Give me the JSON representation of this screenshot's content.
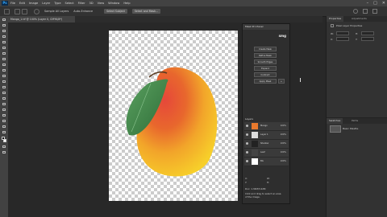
{
  "app": {
    "logo": "Ps"
  },
  "menu": [
    "File",
    "Edit",
    "Image",
    "Layer",
    "Type",
    "Select",
    "Filter",
    "3D",
    "View",
    "Window",
    "Help"
  ],
  "window_controls": {
    "minimize": "–",
    "maximize": "□",
    "close": "✕"
  },
  "options_bar": {
    "sample_all_layers": "Sample All Layers",
    "auto_enhance": "Auto-Enhance",
    "select_subject": "Select Subject",
    "select_mask": "Select and Mask..."
  },
  "document": {
    "tab_title": "Mango_1.tif @ 100% (Layer 0, CMYK/8*)"
  },
  "plugin_panel": {
    "header": "Mask Pro Panel",
    "logo": "smg",
    "buttons": [
      "Create Mask",
      "Refine Mask",
      "Smooth Edges",
      "Expand",
      "Contract",
      "Apply Mask"
    ],
    "small_button": "+",
    "layers_title": "Layers",
    "layers": [
      {
        "name": "Mango",
        "value": "100%"
      },
      {
        "name": "Layer 1",
        "value": "100%"
      },
      {
        "name": "Shadow",
        "value": "100%"
      },
      {
        "name": "Leaf",
        "value": "100%"
      },
      {
        "name": "BG",
        "value": "100%"
      }
    ],
    "info_rows": [
      "X:",
      "Y:",
      "W:",
      "H:",
      "Doc: 1.34M/3.22M",
      "Click and drag to select an area",
      "of the image."
    ]
  },
  "right_panel": {
    "tabs": [
      "Properties",
      "Adjustments"
    ],
    "section_title": "Pixel Layer Properties",
    "rows": [
      "W:",
      "H:",
      "X:",
      "Y:"
    ],
    "tabs2": [
      "Swatches",
      "Paths"
    ],
    "swatch_label": "Basic Palette"
  },
  "colors": {
    "mango_red": "#d8462b",
    "mango_yellow": "#f2c02a",
    "leaf": "#3f8a4a",
    "accent": "#31a8ff"
  }
}
